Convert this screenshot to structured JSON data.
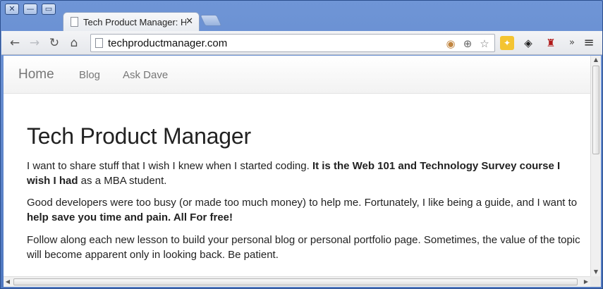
{
  "window": {
    "controls": {
      "close": "✕",
      "minimize": "—",
      "maximize": "▭"
    }
  },
  "tab": {
    "title": "Tech Product Manager: H",
    "close_glyph": "✕",
    "icon": "page-icon"
  },
  "toolbar": {
    "back_glyph": "←",
    "forward_glyph": "→",
    "reload_glyph": "↻",
    "home_glyph": "⌂",
    "url": "techproductmanager.com",
    "omnibox_icons": [
      "cookie-blocked-icon",
      "zoom-icon",
      "star-icon"
    ],
    "star_glyph": "☆",
    "zoom_glyph": "⊕",
    "cookie_glyph": "◉",
    "extensions": [
      "extension-yellow-icon",
      "layers-icon",
      "armchair-icon"
    ],
    "more_glyph": "»",
    "menu_glyph": "≡"
  },
  "site": {
    "nav": {
      "brand": "Home",
      "links": [
        "Blog",
        "Ask Dave"
      ]
    },
    "title": "Tech Product Manager",
    "paragraphs": [
      {
        "plain": "I want to share stuff that I wish I knew when I started coding. ",
        "bold": "It is the Web 101 and Technology Survey course I wish I had",
        "after": " as a MBA student."
      },
      {
        "plain": "Good developers were too busy (or made too much money) to help me. Fortunately, I like being a guide, and I want to ",
        "bold": "help save you time and pain. All For free!",
        "after": ""
      },
      {
        "plain": "Follow along each new lesson to build your personal blog or personal portfolio page. Sometimes, the value of the topic will become apparent only in looking back. Be patient.",
        "bold": "",
        "after": ""
      }
    ]
  },
  "colors": {
    "frame": "#5f86c9",
    "text": "#222222",
    "nav_text": "#777777"
  }
}
